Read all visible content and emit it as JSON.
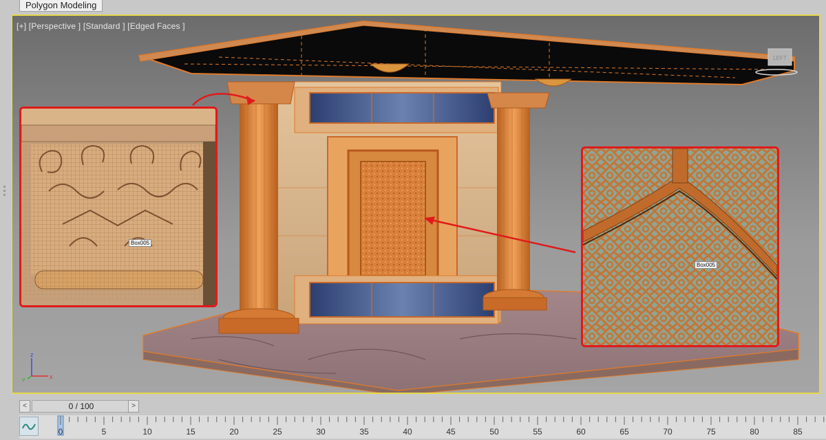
{
  "ribbon": {
    "active_tab": "Polygon Modeling"
  },
  "viewport": {
    "label": "[+] [Perspective ] [Standard ] [Edged Faces ]",
    "selection_tags": [
      "Box005",
      "Box005"
    ],
    "viewcube_text": "LEFT"
  },
  "axis_tripod": {
    "x": "x",
    "y": "y",
    "z": "z"
  },
  "timeline": {
    "prev_label": "<",
    "next_label": ">",
    "frame_counter": "0 / 100",
    "current_frame": 0,
    "ticks": [
      "0",
      "5",
      "10",
      "15",
      "20",
      "25",
      "30",
      "35",
      "40",
      "45",
      "50",
      "55",
      "60",
      "65",
      "70",
      "75",
      "80",
      "85"
    ]
  },
  "colors": {
    "viewport_border": "#e6d84a",
    "wire_orange": "#e07a2a",
    "callout_red": "#e01a1a"
  }
}
